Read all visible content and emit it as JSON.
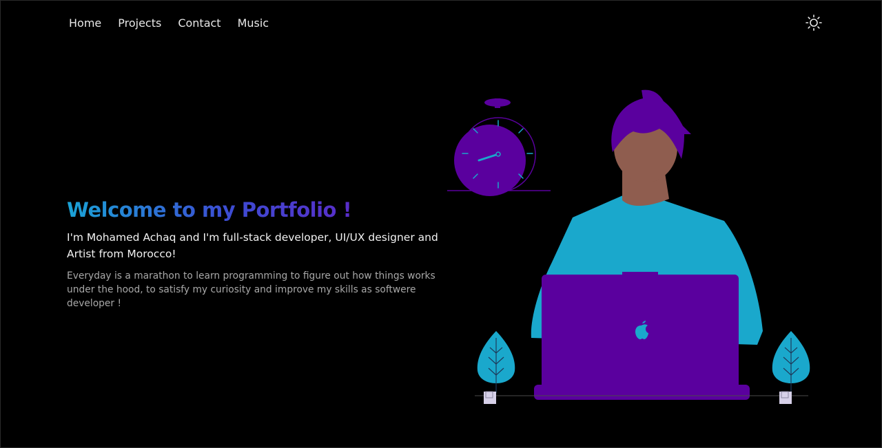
{
  "nav": {
    "items": [
      {
        "label": "Home"
      },
      {
        "label": "Projects"
      },
      {
        "label": "Contact"
      },
      {
        "label": "Music"
      }
    ],
    "theme_toggle_icon": "sun-icon"
  },
  "hero": {
    "title": "Welcome to my Portfolio !",
    "intro": "I'm Mohamed Achaq and I'm full-stack developer, UI/UX designer and Artist from Morocco!",
    "description": "Everyday is a marathon to learn programming to figure out how things works under the hood, to satisfy my curiosity and improve my skills as softwere developer !"
  },
  "colors": {
    "background": "#000000",
    "accent_purple": "#5a009e",
    "accent_cyan": "#1aa8cc",
    "skin": "#8f5d4f"
  },
  "illustration": {
    "icons": [
      "stopwatch-icon",
      "developer-figure",
      "laptop-icon",
      "apple-logo-icon",
      "plant-icon"
    ]
  }
}
